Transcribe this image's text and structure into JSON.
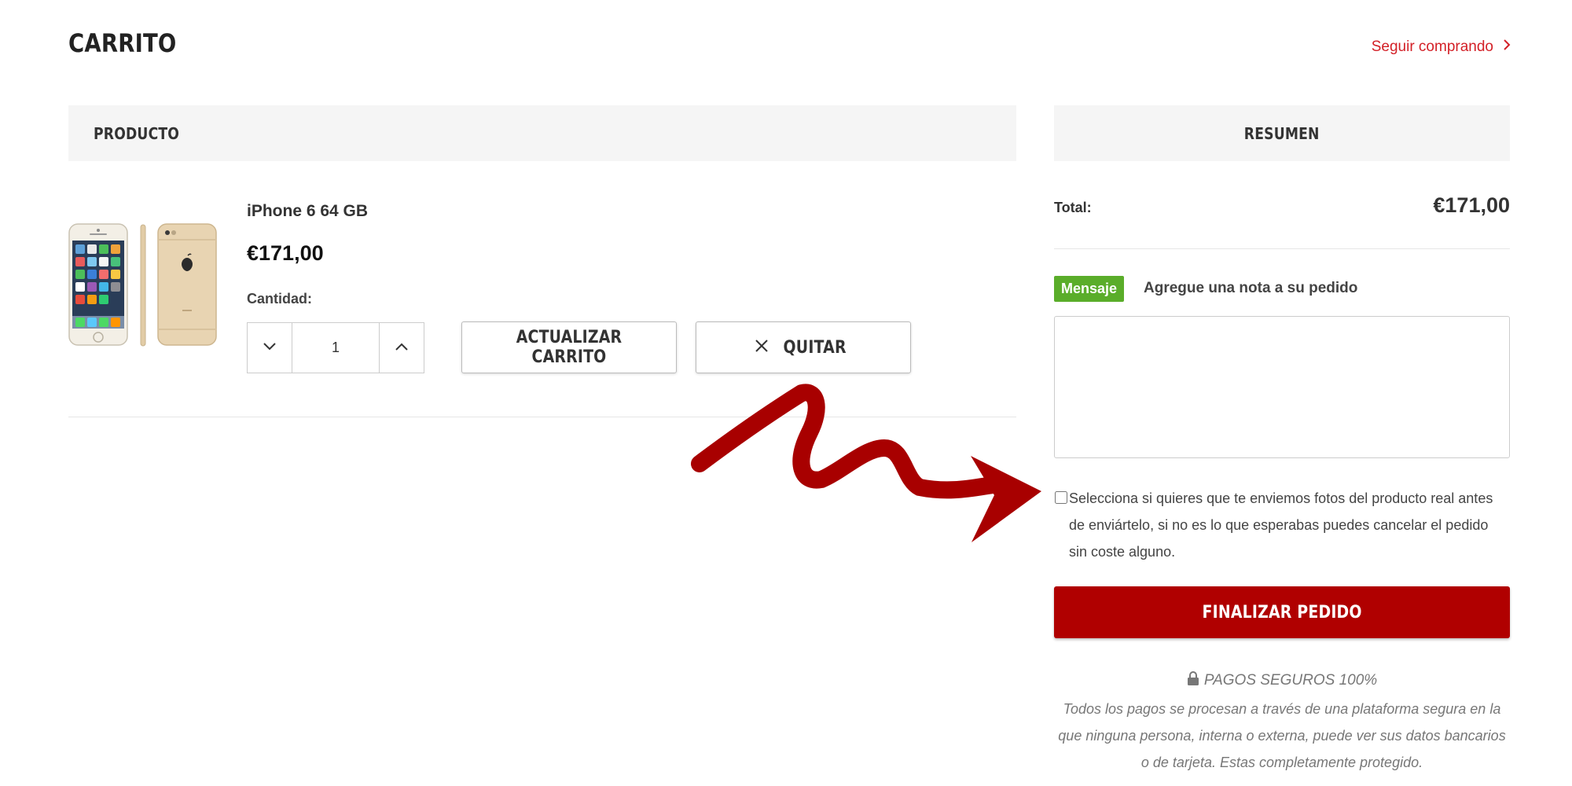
{
  "page": {
    "title": "CARRITO",
    "continue_link": "Seguir comprando"
  },
  "product_table": {
    "header": "PRODUCTO",
    "items": [
      {
        "name": "iPhone 6 64 GB",
        "price": "€171,00",
        "quantity_label": "Cantidad:",
        "quantity": "1"
      }
    ],
    "update_button": "ACTUALIZAR CARRITO",
    "remove_button": "QUITAR"
  },
  "summary": {
    "header": "RESUMEN",
    "total_label": "Total:",
    "total_value": "€171,00",
    "message_badge": "Mensaje",
    "message_label": "Agregue una nota a su pedido",
    "photo_option": "Selecciona si quieres que te enviemos fotos del producto real antes de enviártelo, si no es lo que esperabas puedes cancelar el pedido sin coste alguno.",
    "checkout_button": "FINALIZAR PEDIDO",
    "secure_title": "PAGOS SEGUROS 100%",
    "secure_text": "Todos los pagos se procesan a través de una plataforma segura en la que ninguna persona, interna o externa, puede ver sus datos bancarios o de tarjeta. Estas completamente protegido."
  },
  "icons": {
    "continue": "chevron-right-icon",
    "decrease": "chevron-down-icon",
    "increase": "chevron-up-icon",
    "remove": "close-icon",
    "secure": "lock-icon"
  },
  "colors": {
    "accent_red": "#d32027",
    "checkout_red": "#b00000",
    "message_green": "#5aad2a",
    "annotation_red": "#a80000"
  }
}
